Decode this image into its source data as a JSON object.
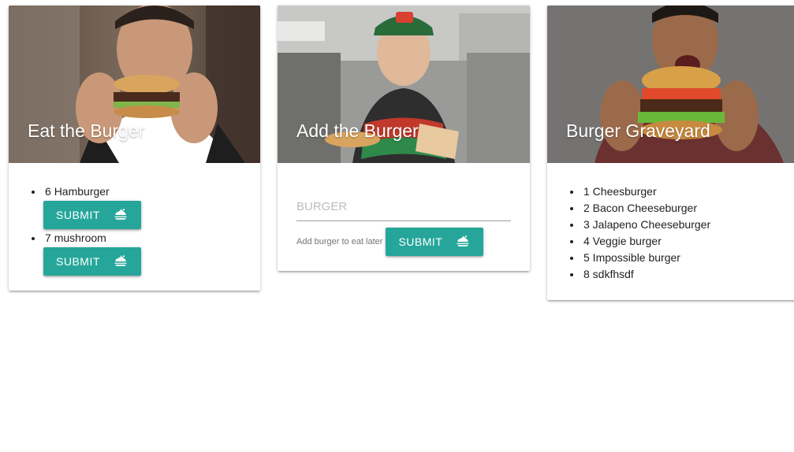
{
  "cards": {
    "eat": {
      "title": "Eat the Burger",
      "items": [
        {
          "id": "6",
          "name": "Hamburger",
          "button": "SUBMIT"
        },
        {
          "id": "7",
          "name": "mushroom",
          "button": "SUBMIT"
        }
      ]
    },
    "add": {
      "title": "Add the Burger",
      "input_placeholder": "BURGER",
      "input_value": "",
      "helper": "Add burger to eat later",
      "button": "SUBMIT"
    },
    "graveyard": {
      "title": "Burger Graveyard",
      "items": [
        {
          "text": "1 Cheesburger"
        },
        {
          "text": "2 Bacon Cheeseburger"
        },
        {
          "text": "3 Jalapeno Cheeseburger"
        },
        {
          "text": "4 Veggie burger"
        },
        {
          "text": "5 Impossible burger"
        },
        {
          "text": "8 sdkfhsdf"
        }
      ]
    }
  },
  "theme": {
    "accent": "#26a69a"
  },
  "icons": {
    "submit": "food-cloche-icon"
  }
}
